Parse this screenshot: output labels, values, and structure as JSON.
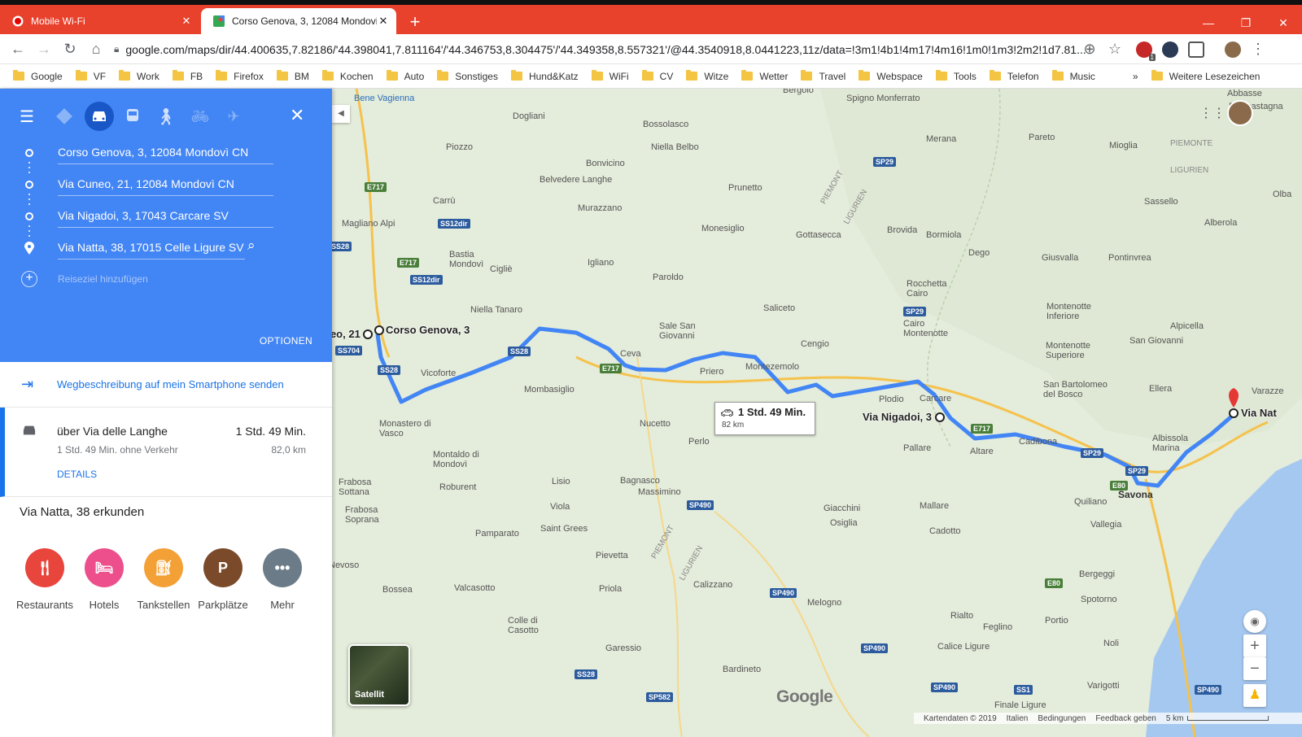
{
  "browser": {
    "tabs": [
      {
        "title": "Mobile Wi-Fi",
        "active": false
      },
      {
        "title": "Corso Genova, 3, 12084 Mondovi",
        "active": true
      }
    ],
    "url": "google.com/maps/dir/44.400635,7.82186/'44.398041,7.811164'/'44.346753,8.304475'/'44.349358,8.557321'/@44.3540918,8.0441223,11z/data=!3m1!4b1!4m17!4m16!1m0!1m3!2m2!1d7.81...",
    "bookmarks": [
      "Google",
      "VF",
      "Work",
      "FB",
      "Firefox",
      "BM",
      "Kochen",
      "Auto",
      "Sonstiges",
      "Hund&Katz",
      "WiFi",
      "CV",
      "Witze",
      "Wetter",
      "Travel",
      "Webspace",
      "Tools",
      "Telefon",
      "Music"
    ],
    "bookmarks_more": "»",
    "other_bookmarks": "Weitere Lesezeichen",
    "ext_badge": "1",
    "colors": {
      "tabbar": "#e8412c",
      "accent": "#4285f4"
    }
  },
  "directions": {
    "stops": [
      "Corso Genova, 3, 12084 Mondovì CN",
      "Via Cuneo, 21, 12084 Mondovì CN",
      "Via Nigadoi, 3, 17043 Carcare SV",
      "Via Natta, 38, 17015 Celle Ligure SV"
    ],
    "add_stop": "Reiseziel hinzufügen",
    "options": "OPTIONEN",
    "send_to_phone": "Wegbeschreibung auf mein Smartphone senden",
    "route": {
      "via": "über Via delle Langhe",
      "duration": "1 Std. 49 Min.",
      "duration_note": "1 Std. 49 Min. ohne Verkehr",
      "distance": "82,0 km",
      "details": "DETAILS"
    },
    "explore_title": "Via Natta, 38 erkunden",
    "pois": [
      {
        "label": "Restaurants",
        "color": "#e8453c",
        "icon": "restaurant-icon"
      },
      {
        "label": "Hotels",
        "color": "#ec4f8c",
        "icon": "hotel-icon"
      },
      {
        "label": "Tankstellen",
        "color": "#f3a136",
        "icon": "gas-station-icon"
      },
      {
        "label": "Parkplätze",
        "color": "#7a4a2a",
        "icon": "parking-icon"
      },
      {
        "label": "Mehr",
        "color": "#6b7b87",
        "icon": "more-icon"
      }
    ]
  },
  "map": {
    "route_box": {
      "time": "1 Std. 49 Min.",
      "distance": "82 km"
    },
    "waypoint_labels": [
      "neo, 21",
      "Corso Genova, 3",
      "Via Nigadoi, 3",
      "Via Nat"
    ],
    "places": [
      "Bene Vagienna",
      "Bergolo",
      "Dogliani",
      "Bossolasco",
      "Niella Belbo",
      "Piozzo",
      "Bonvicino",
      "Carrù",
      "Belvedere Langhe",
      "Murazzano",
      "Prunetto",
      "Spigno Monferrato",
      "Merana",
      "Pareto",
      "Mioglia",
      "Sassello",
      "Abbasse",
      "Magliano Alpi",
      "Monesiglio",
      "Gottasecca",
      "Brovida",
      "Bormiola",
      "Dego",
      "Giusvalla",
      "Pontinvrea",
      "Alberola",
      "Bastia Mondovì",
      "Cigliè",
      "Igliano",
      "Paroldo",
      "Rocchetta Cairo",
      "Niella Tanaro",
      "Saliceto",
      "Cairo Montenotte",
      "Montenotte Inferiore",
      "Alpicella",
      "Sale San Giovanni",
      "Cengio",
      "Montenotte Superiore",
      "San Giovanni",
      "Ceva",
      "Priero",
      "Montezemolo",
      "Plodio",
      "Carcare",
      "San Bartolomeo del Bosco",
      "Ellera",
      "Vicoforte",
      "Mombasiglio",
      "Nucetto",
      "Altare",
      "Cadibona",
      "Albissola Marina",
      "Varazze",
      "Monastero di Vasco",
      "Perlo",
      "Pallare",
      "Montaldo di Mondovì",
      "Frabosa Sottana",
      "Roburent",
      "Bagnasco",
      "Massimino",
      "Quiliano",
      "Savona",
      "Frabosa Soprana",
      "Lisio",
      "Viola",
      "Pamparato",
      "Saint Grees",
      "Giacchini",
      "Osiglia",
      "Mallare",
      "Cadotto",
      "Vallegia",
      "Pievetta",
      "Bergeggi",
      "Nevoso",
      "Bossea",
      "Valcasotto",
      "Priola",
      "Calizzano",
      "Melogno",
      "Rialto",
      "Portio",
      "Spotorno",
      "Colle di Casotto",
      "Garessio",
      "Feglino",
      "Calice Ligure",
      "Noli",
      "Bardineto",
      "Varigotti",
      "Finale Ligure",
      "Piancastagna",
      "Olba"
    ],
    "regions": [
      "PIEMONTE",
      "LIGURIEN",
      "PIEMONT",
      "LIGURIEN",
      "PIEMONT",
      "LIGURIEN"
    ],
    "roads": [
      "E717",
      "SS12dir",
      "SS28",
      "E717",
      "SS12dir",
      "SS704",
      "SS28",
      "SS28",
      "E717",
      "SP29",
      "SP29",
      "E717",
      "SP29",
      "SP29",
      "E80",
      "SP490",
      "SP490",
      "E80",
      "SP490",
      "SP490",
      "SS28",
      "SP582",
      "SS1",
      "SP490"
    ],
    "satellite_label": "Satellit",
    "google_logo": "Google",
    "attribution": [
      "Kartendaten © 2019",
      "Italien",
      "Bedingungen",
      "Feedback geben",
      "5 km"
    ],
    "route_color": "#4285f4"
  }
}
